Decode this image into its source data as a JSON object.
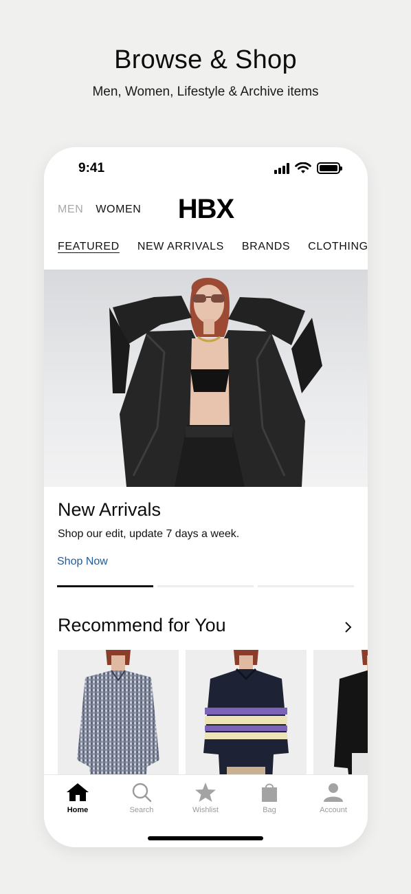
{
  "promo": {
    "title": "Browse & Shop",
    "subtitle": "Men, Women, Lifestyle & Archive items"
  },
  "status_bar": {
    "time": "9:41",
    "icons": [
      "signal-icon",
      "wifi-icon",
      "battery-icon"
    ]
  },
  "header": {
    "gender_tabs": [
      {
        "label": "MEN",
        "selected": false
      },
      {
        "label": "WOMEN",
        "selected": true
      }
    ],
    "logo": "HBX"
  },
  "categories": [
    {
      "label": "FEATURED",
      "active": true
    },
    {
      "label": "NEW ARRIVALS",
      "active": false
    },
    {
      "label": "BRANDS",
      "active": false
    },
    {
      "label": "CLOTHING",
      "active": false
    }
  ],
  "banner": {
    "title": "New Arrivals",
    "description": "Shop our edit, update 7 days a week.",
    "cta": "Shop Now",
    "slide_count": 3,
    "active_slide": 1
  },
  "recommend": {
    "title": "Recommend for You",
    "products": [
      {
        "name": "gingham-shirt"
      },
      {
        "name": "striped-polo-sweater"
      },
      {
        "name": "black-knit-cardigan"
      }
    ]
  },
  "tabbar": {
    "tabs": [
      {
        "label": "Home",
        "icon": "home-icon",
        "active": true
      },
      {
        "label": "Search",
        "icon": "search-icon",
        "active": false
      },
      {
        "label": "Wishlist",
        "icon": "star-icon",
        "active": false
      },
      {
        "label": "Bag",
        "icon": "bag-icon",
        "active": false
      },
      {
        "label": "Account",
        "icon": "account-icon",
        "active": false
      }
    ]
  },
  "colors": {
    "background": "#f0f0ef",
    "link": "#1f5a9c",
    "inactive_tab": "#9a9a9a",
    "text": "#111111"
  }
}
